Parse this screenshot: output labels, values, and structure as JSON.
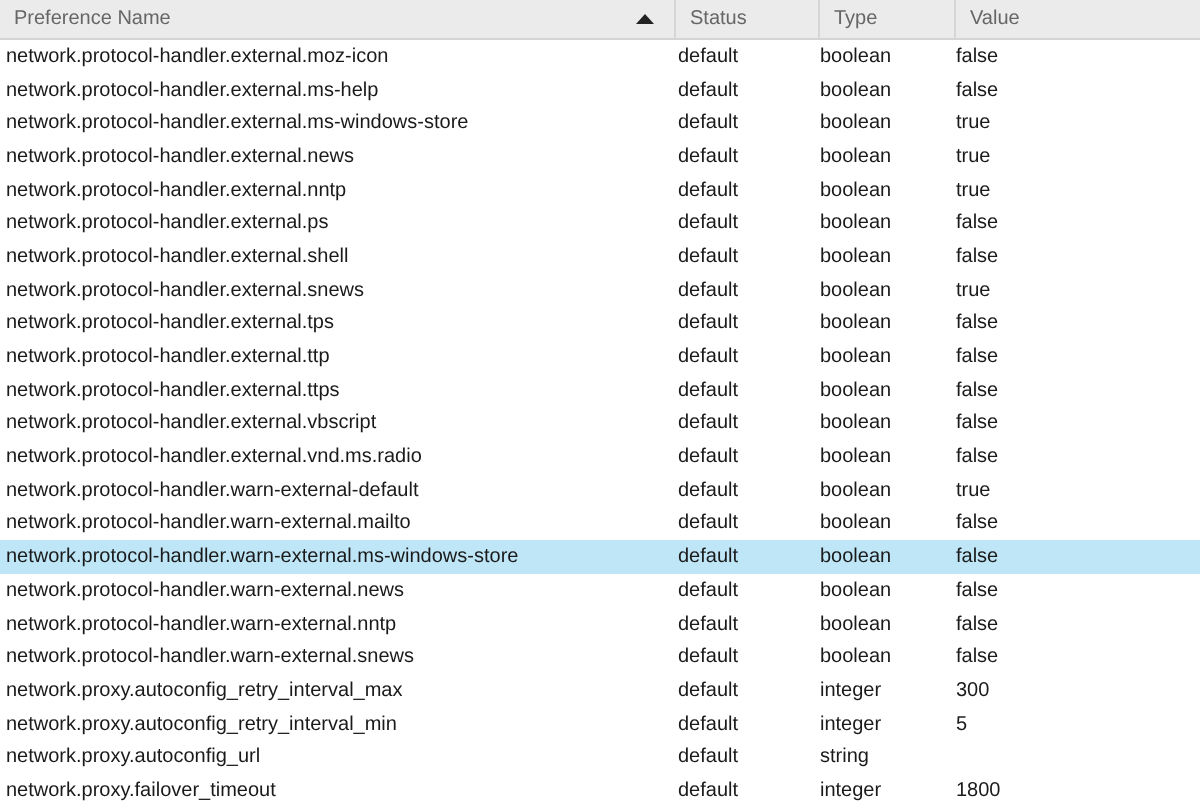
{
  "table": {
    "columns": [
      {
        "label": "Preference Name",
        "sorted": true
      },
      {
        "label": "Status",
        "sorted": false
      },
      {
        "label": "Type",
        "sorted": false
      },
      {
        "label": "Value",
        "sorted": false
      }
    ],
    "rows": [
      {
        "name": "network.protocol-handler.external.moz-icon",
        "status": "default",
        "type": "boolean",
        "value": "false",
        "selected": false
      },
      {
        "name": "network.protocol-handler.external.ms-help",
        "status": "default",
        "type": "boolean",
        "value": "false",
        "selected": false
      },
      {
        "name": "network.protocol-handler.external.ms-windows-store",
        "status": "default",
        "type": "boolean",
        "value": "true",
        "selected": false
      },
      {
        "name": "network.protocol-handler.external.news",
        "status": "default",
        "type": "boolean",
        "value": "true",
        "selected": false
      },
      {
        "name": "network.protocol-handler.external.nntp",
        "status": "default",
        "type": "boolean",
        "value": "true",
        "selected": false
      },
      {
        "name": "network.protocol-handler.external.ps",
        "status": "default",
        "type": "boolean",
        "value": "false",
        "selected": false
      },
      {
        "name": "network.protocol-handler.external.shell",
        "status": "default",
        "type": "boolean",
        "value": "false",
        "selected": false
      },
      {
        "name": "network.protocol-handler.external.snews",
        "status": "default",
        "type": "boolean",
        "value": "true",
        "selected": false
      },
      {
        "name": "network.protocol-handler.external.tps",
        "status": "default",
        "type": "boolean",
        "value": "false",
        "selected": false
      },
      {
        "name": "network.protocol-handler.external.ttp",
        "status": "default",
        "type": "boolean",
        "value": "false",
        "selected": false
      },
      {
        "name": "network.protocol-handler.external.ttps",
        "status": "default",
        "type": "boolean",
        "value": "false",
        "selected": false
      },
      {
        "name": "network.protocol-handler.external.vbscript",
        "status": "default",
        "type": "boolean",
        "value": "false",
        "selected": false
      },
      {
        "name": "network.protocol-handler.external.vnd.ms.radio",
        "status": "default",
        "type": "boolean",
        "value": "false",
        "selected": false
      },
      {
        "name": "network.protocol-handler.warn-external-default",
        "status": "default",
        "type": "boolean",
        "value": "true",
        "selected": false
      },
      {
        "name": "network.protocol-handler.warn-external.mailto",
        "status": "default",
        "type": "boolean",
        "value": "false",
        "selected": false
      },
      {
        "name": "network.protocol-handler.warn-external.ms-windows-store",
        "status": "default",
        "type": "boolean",
        "value": "false",
        "selected": true
      },
      {
        "name": "network.protocol-handler.warn-external.news",
        "status": "default",
        "type": "boolean",
        "value": "false",
        "selected": false
      },
      {
        "name": "network.protocol-handler.warn-external.nntp",
        "status": "default",
        "type": "boolean",
        "value": "false",
        "selected": false
      },
      {
        "name": "network.protocol-handler.warn-external.snews",
        "status": "default",
        "type": "boolean",
        "value": "false",
        "selected": false
      },
      {
        "name": "network.proxy.autoconfig_retry_interval_max",
        "status": "default",
        "type": "integer",
        "value": "300",
        "selected": false
      },
      {
        "name": "network.proxy.autoconfig_retry_interval_min",
        "status": "default",
        "type": "integer",
        "value": "5",
        "selected": false
      },
      {
        "name": "network.proxy.autoconfig_url",
        "status": "default",
        "type": "string",
        "selected": false
      },
      {
        "name": "network.proxy.failover_timeout",
        "status": "default",
        "type": "integer",
        "value": "1800",
        "selected": false
      }
    ]
  }
}
